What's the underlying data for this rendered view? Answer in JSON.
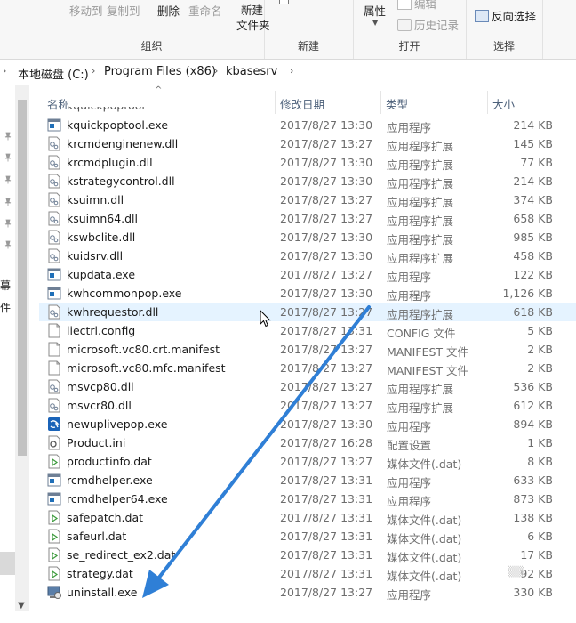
{
  "ribbon": {
    "organize": {
      "move_to": "移动到",
      "copy_to": "复制到",
      "delete": "删除",
      "rename": "重命名",
      "label": "组织"
    },
    "new": {
      "new_folder_line1": "新建",
      "new_folder_line2": "文件夹",
      "label": "新建"
    },
    "open": {
      "properties": "属性",
      "edit": "编辑",
      "history": "历史记录",
      "label": "打开"
    },
    "select": {
      "invert": "反向选择",
      "label": "选择"
    }
  },
  "address": {
    "crumbs": [
      "本地磁盘 (C:)",
      "Program Files (x86)",
      "kbasesrv"
    ]
  },
  "nav": {
    "text1": "幕",
    "text2": "件"
  },
  "list": {
    "headers": {
      "name": "名称",
      "date": "修改日期",
      "type": "类型",
      "size": "大小"
    },
    "rows": [
      {
        "name": "kquickpoptool.exe",
        "date": "2017/8/27 13:30",
        "type": "应用程序",
        "size": "214 KB",
        "icon": "exe-icon"
      },
      {
        "name": "krcmdenginenew.dll",
        "date": "2017/8/27 13:27",
        "type": "应用程序扩展",
        "size": "145 KB",
        "icon": "dll-icon"
      },
      {
        "name": "krcmdplugin.dll",
        "date": "2017/8/27 13:30",
        "type": "应用程序扩展",
        "size": "77 KB",
        "icon": "dll-icon"
      },
      {
        "name": "kstrategycontrol.dll",
        "date": "2017/8/27 13:30",
        "type": "应用程序扩展",
        "size": "214 KB",
        "icon": "dll-icon"
      },
      {
        "name": "ksuimn.dll",
        "date": "2017/8/27 13:27",
        "type": "应用程序扩展",
        "size": "374 KB",
        "icon": "dll-icon"
      },
      {
        "name": "ksuimn64.dll",
        "date": "2017/8/27 13:27",
        "type": "应用程序扩展",
        "size": "658 KB",
        "icon": "dll-icon"
      },
      {
        "name": "kswbclite.dll",
        "date": "2017/8/27 13:30",
        "type": "应用程序扩展",
        "size": "985 KB",
        "icon": "dll-icon"
      },
      {
        "name": "kuidsrv.dll",
        "date": "2017/8/27 13:30",
        "type": "应用程序扩展",
        "size": "458 KB",
        "icon": "dll-icon"
      },
      {
        "name": "kupdata.exe",
        "date": "2017/8/27 13:27",
        "type": "应用程序",
        "size": "122 KB",
        "icon": "exe-icon"
      },
      {
        "name": "kwhcommonpop.exe",
        "date": "2017/8/27 13:30",
        "type": "应用程序",
        "size": "1,126 KB",
        "icon": "exe-icon"
      },
      {
        "name": "kwhrequestor.dll",
        "date": "2017/8/27 13:27",
        "type": "应用程序扩展",
        "size": "618 KB",
        "icon": "dll-icon",
        "hover": true
      },
      {
        "name": "liectrl.config",
        "date": "2017/8/27 13:31",
        "type": "CONFIG 文件",
        "size": "5 KB",
        "icon": "file-icon"
      },
      {
        "name": "microsoft.vc80.crt.manifest",
        "date": "2017/8/27 13:27",
        "type": "MANIFEST 文件",
        "size": "2 KB",
        "icon": "file-icon"
      },
      {
        "name": "microsoft.vc80.mfc.manifest",
        "date": "2017/8/27 13:27",
        "type": "MANIFEST 文件",
        "size": "2 KB",
        "icon": "file-icon"
      },
      {
        "name": "msvcp80.dll",
        "date": "2017/8/27 13:27",
        "type": "应用程序扩展",
        "size": "536 KB",
        "icon": "dll-icon"
      },
      {
        "name": "msvcr80.dll",
        "date": "2017/8/27 13:27",
        "type": "应用程序扩展",
        "size": "612 KB",
        "icon": "dll-icon"
      },
      {
        "name": "newuplivepop.exe",
        "date": "2017/8/27 13:30",
        "type": "应用程序",
        "size": "894 KB",
        "icon": "exe-blue-icon"
      },
      {
        "name": "Product.ini",
        "date": "2017/8/27 16:28",
        "type": "配置设置",
        "size": "1 KB",
        "icon": "ini-icon"
      },
      {
        "name": "productinfo.dat",
        "date": "2017/8/27 13:27",
        "type": "媒体文件(.dat)",
        "size": "8 KB",
        "icon": "media-icon"
      },
      {
        "name": "rcmdhelper.exe",
        "date": "2017/8/27 13:31",
        "type": "应用程序",
        "size": "633 KB",
        "icon": "exe-icon"
      },
      {
        "name": "rcmdhelper64.exe",
        "date": "2017/8/27 13:31",
        "type": "应用程序",
        "size": "873 KB",
        "icon": "exe-icon"
      },
      {
        "name": "safepatch.dat",
        "date": "2017/8/27 13:31",
        "type": "媒体文件(.dat)",
        "size": "138 KB",
        "icon": "media-icon"
      },
      {
        "name": "safeurl.dat",
        "date": "2017/8/27 13:31",
        "type": "媒体文件(.dat)",
        "size": "6 KB",
        "icon": "media-icon"
      },
      {
        "name": "se_redirect_ex2.dat",
        "date": "2017/8/27 13:31",
        "type": "媒体文件(.dat)",
        "size": "17 KB",
        "icon": "media-icon"
      },
      {
        "name": "strategy.dat",
        "date": "2017/8/27 13:31",
        "type": "媒体文件(.dat)",
        "size": "92 KB",
        "icon": "media-icon"
      },
      {
        "name": "uninstall.exe",
        "date": "2017/8/27 13:27",
        "type": "应用程序",
        "size": "330 KB",
        "icon": "uninstall-icon"
      }
    ]
  },
  "colors": {
    "hover_row": "#e5f3ff",
    "header_text": "#4c607a",
    "arrow": "#2f7fd6"
  }
}
